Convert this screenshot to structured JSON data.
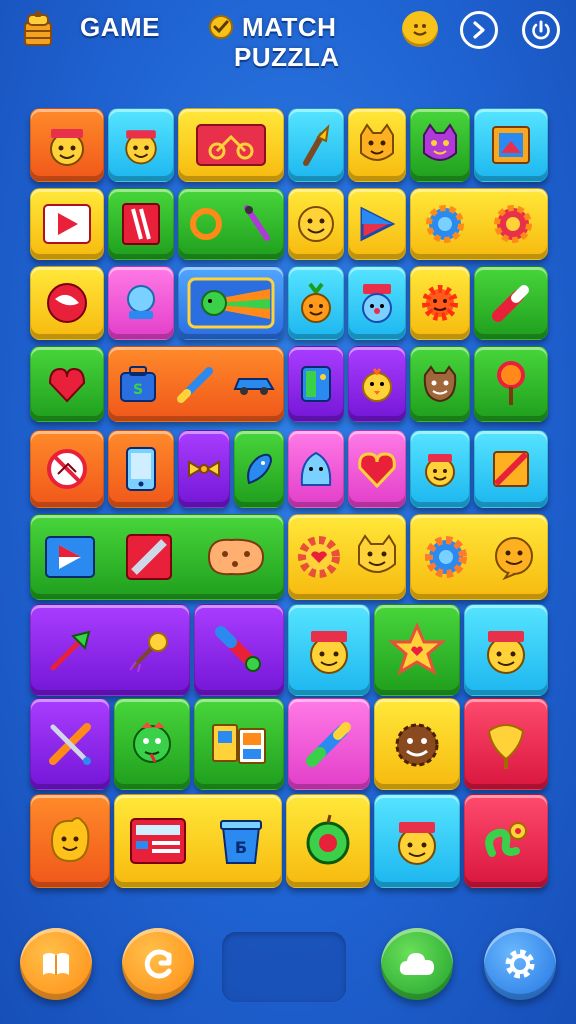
{
  "header": {
    "title_left": "GAME",
    "title_right_line1": "MATCH",
    "title_right_line2": "PUZZLA",
    "left_icon": "treasure-chest-icon",
    "badge_icon": "gold-check-badge-icon",
    "buttons": [
      "coin-smiley-icon",
      "skip-forward-icon",
      "power-icon"
    ]
  },
  "board": {
    "rows": 9,
    "tile_colors": [
      "orange",
      "cyan",
      "yellow",
      "green",
      "purple",
      "pink",
      "blue",
      "red"
    ]
  },
  "bottom_bar": {
    "buttons": [
      "book-icon",
      "restart-icon",
      "cloud-icon",
      "settings-gear-icon"
    ],
    "colors": {
      "orange": "#ff9a1a",
      "green": "#2fc03a",
      "blue": "#2a8cf0"
    }
  },
  "colors": {
    "background": "#1f63d2",
    "header_text": "#ffffff"
  }
}
